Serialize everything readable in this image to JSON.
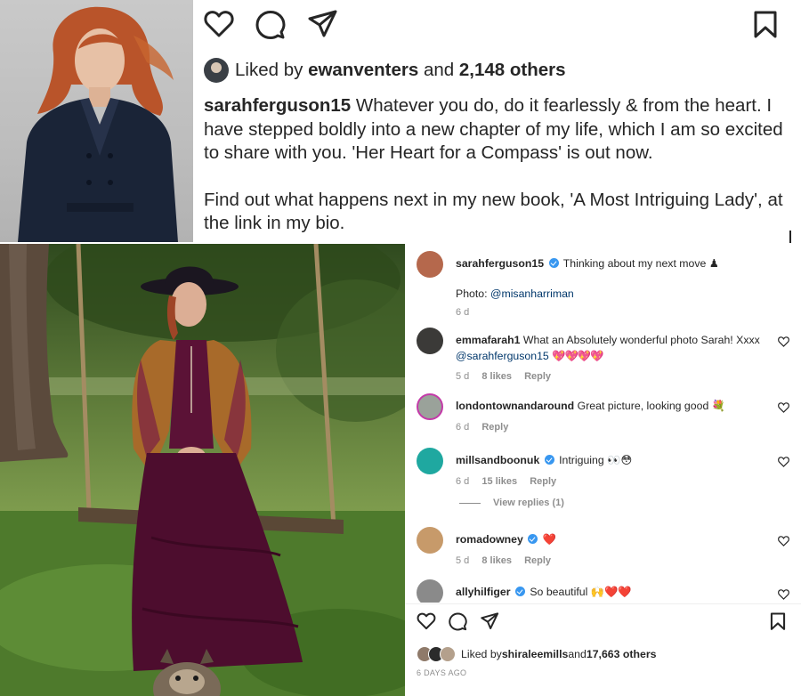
{
  "top_post": {
    "liked_by_prefix": "Liked by ",
    "liked_by_user": "ewanventers",
    "liked_by_mid": " and ",
    "liked_by_count": "2,148 others",
    "caption_user": "sarahferguson15",
    "caption_line1": " Whatever you do, do it fearlessly & from the heart. I have stepped boldly into a new chapter of my life, which I am so excited to share with you. 'Her Heart for a Compass' is out now.",
    "caption_line2": "Find out what happens next in my new book, 'A Most Intriguing Lady', at the link in my bio."
  },
  "comments": [
    {
      "user": "sarahferguson15",
      "verified": true,
      "text": "Thinking about my next move ♟",
      "extra_prefix": "Photo: ",
      "extra_link": "@misanharriman",
      "time": "6 d",
      "avatar_color": "#b5684c"
    },
    {
      "user": "emmafarah1",
      "text": "What an Absolutely wonderful photo Sarah! Xxxx ",
      "mention": "@sarahferguson15",
      "emoji": "💖💖💖💖",
      "time": "5 d",
      "likes": "8 likes",
      "reply": "Reply",
      "avatar_color": "#3b3a38"
    },
    {
      "user": "londontownandaround",
      "text": "Great picture, looking good 💐",
      "time": "6 d",
      "reply": "Reply",
      "avatar_color": "#9aa29a"
    },
    {
      "user": "millsandboonuk",
      "verified": true,
      "text": "Intriguing 👀😳",
      "time": "6 d",
      "likes": "15 likes",
      "reply": "Reply",
      "avatar_color": "#1fa8a0"
    },
    {
      "view_replies": "View replies (1)"
    },
    {
      "user": "romadowney",
      "verified": true,
      "text": "❤️",
      "time": "5 d",
      "likes": "8 likes",
      "reply": "Reply",
      "avatar_color": "#c79a6a"
    },
    {
      "user": "allyhilfiger",
      "verified": true,
      "text": "So beautiful 🙌❤️❤️",
      "avatar_color": "#8a8a8a"
    }
  ],
  "bottom_post": {
    "liked_by_prefix": "Liked by ",
    "liked_by_user": "shiraleemills",
    "liked_by_mid": " and ",
    "liked_by_count": "17,663 others",
    "date": "6 DAYS AGO"
  },
  "icons": [
    "heart-icon",
    "comment-icon",
    "share-icon",
    "bookmark-icon"
  ],
  "colors": {
    "verified": "#3897f0",
    "link": "#00376b",
    "muted": "#8e8e8e"
  }
}
